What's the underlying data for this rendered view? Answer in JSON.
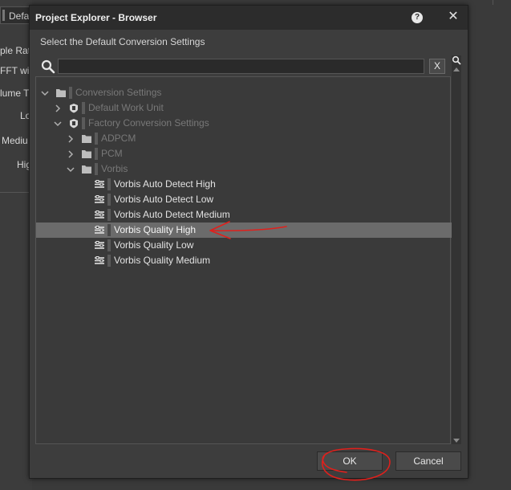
{
  "background": {
    "tab_label": "Defa",
    "labels": [
      "ple Rat",
      "FFT wir",
      "lume T",
      "Lo",
      "Mediu",
      "Hig"
    ]
  },
  "dialog": {
    "title": "Project Explorer - Browser",
    "help_label": "?",
    "close_label": "✕",
    "prompt": "Select the Default Conversion Settings",
    "search": {
      "value": "",
      "placeholder": "",
      "clear_label": "X"
    },
    "tree": [
      {
        "label": "Conversion Settings",
        "level": 0,
        "expanded": true,
        "type": "folder",
        "dim": true
      },
      {
        "label": "Default Work Unit",
        "level": 1,
        "expanded": false,
        "type": "workunit",
        "dim": true
      },
      {
        "label": "Factory Conversion Settings",
        "level": 1,
        "expanded": true,
        "type": "workunit",
        "dim": true
      },
      {
        "label": "ADPCM",
        "level": 2,
        "expanded": false,
        "type": "folder",
        "dim": true
      },
      {
        "label": "PCM",
        "level": 2,
        "expanded": false,
        "type": "folder",
        "dim": true
      },
      {
        "label": "Vorbis",
        "level": 2,
        "expanded": true,
        "type": "folder",
        "dim": true
      },
      {
        "label": "Vorbis Auto Detect High",
        "level": 3,
        "type": "conversion",
        "dim": false
      },
      {
        "label": "Vorbis Auto Detect Low",
        "level": 3,
        "type": "conversion",
        "dim": false
      },
      {
        "label": "Vorbis Auto Detect Medium",
        "level": 3,
        "type": "conversion",
        "dim": false
      },
      {
        "label": "Vorbis Quality High",
        "level": 3,
        "type": "conversion",
        "dim": false,
        "selected": true
      },
      {
        "label": "Vorbis Quality Low",
        "level": 3,
        "type": "conversion",
        "dim": false
      },
      {
        "label": "Vorbis Quality Medium",
        "level": 3,
        "type": "conversion",
        "dim": false
      }
    ],
    "buttons": {
      "ok": "OK",
      "cancel": "Cancel"
    }
  },
  "colors": {
    "selection": "#6b6b6b",
    "annotation": "#e0201c"
  }
}
